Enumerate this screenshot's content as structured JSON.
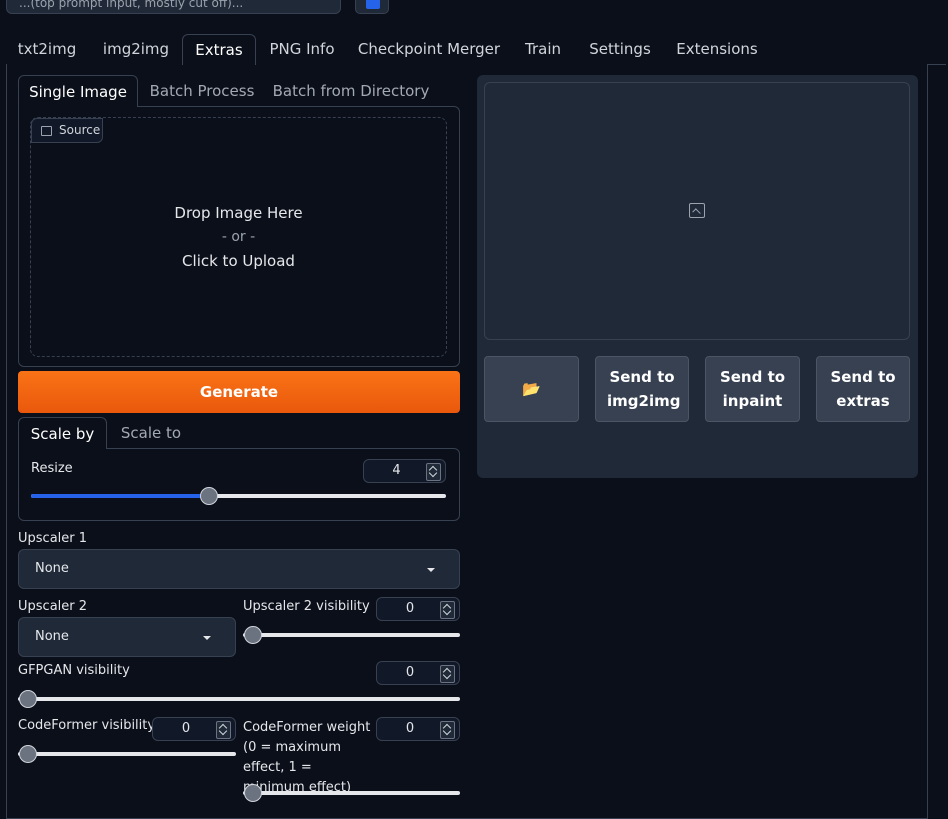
{
  "top": {
    "prompt_text": "...(top prompt input, mostly cut off)..."
  },
  "tabs": [
    "txt2img",
    "img2img",
    "Extras",
    "PNG Info",
    "Checkpoint Merger",
    "Train",
    "Settings",
    "Extensions"
  ],
  "extras": {
    "subtabs": [
      "Single Image",
      "Batch Process",
      "Batch from Directory"
    ],
    "source_label": "Source",
    "drop": {
      "line1": "Drop Image Here",
      "line2": "- or -",
      "line3": "Click to Upload"
    },
    "generate_label": "Generate",
    "scale_tabs": [
      "Scale by",
      "Scale to"
    ],
    "resize": {
      "label": "Resize",
      "value": "4",
      "level": 0.43
    },
    "upscaler1": {
      "label": "Upscaler 1",
      "value": "None"
    },
    "upscaler2": {
      "label": "Upscaler 2",
      "value": "None"
    },
    "upscaler2_visibility": {
      "label": "Upscaler 2 visibility",
      "value": "0",
      "level": 0
    },
    "gfpgan_visibility": {
      "label": "GFPGAN visibility",
      "value": "0",
      "level": 0
    },
    "codeformer_visibility": {
      "label": "CodeFormer visibility",
      "value": "0",
      "level": 0
    },
    "codeformer_weight": {
      "label": "CodeFormer weight (0 = maximum effect, 1 = minimum effect)",
      "value": "0",
      "level": 0
    }
  },
  "output": {
    "folder_icon": "📂",
    "buttons": [
      {
        "label": "Send to img2img"
      },
      {
        "label": "Send to inpaint"
      },
      {
        "label": "Send to extras"
      }
    ]
  },
  "colors": {
    "background": "#0b0f19",
    "accent": "#f97316",
    "slider": "#2563eb"
  }
}
